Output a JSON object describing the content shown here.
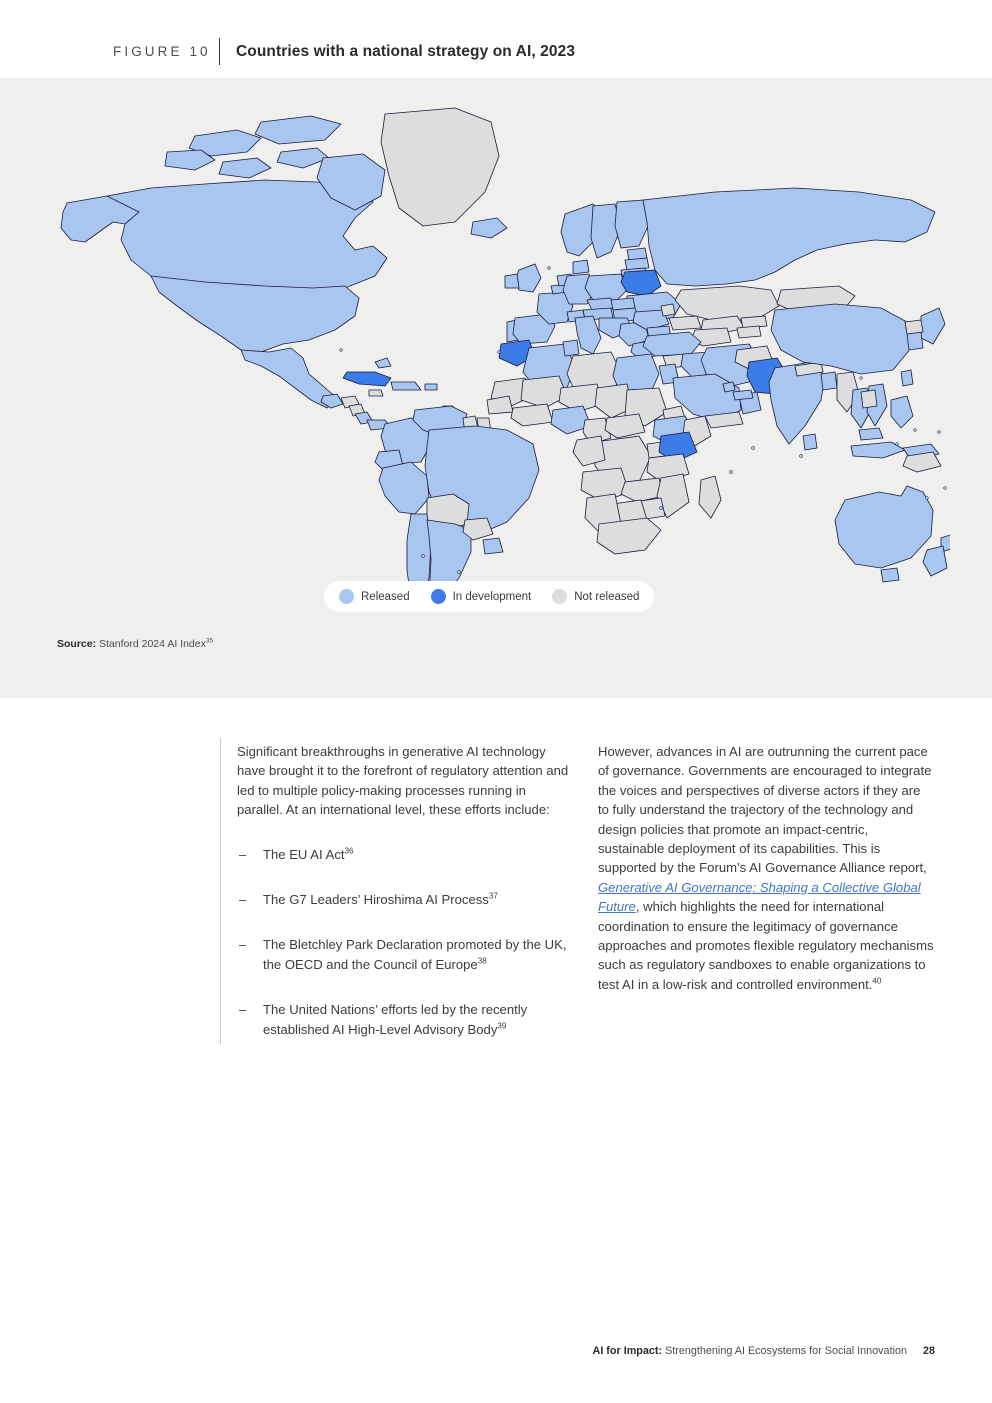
{
  "figure": {
    "label": "FIGURE 10",
    "title": "Countries with a national strategy on AI, 2023",
    "source_label": "Source:",
    "source_text": " Stanford 2024 AI Index",
    "source_superscript": "35"
  },
  "legend": {
    "items": [
      {
        "label": "Released",
        "color": "#a8c6f0",
        "key": "released"
      },
      {
        "label": "In development",
        "color": "#3c7ce8",
        "key": "in-development"
      },
      {
        "label": "Not released",
        "color": "#dcdedd",
        "key": "not-released"
      }
    ]
  },
  "map": {
    "ocean_color": "#efefed",
    "border_color": "#1a1a3c",
    "colors": {
      "released": "#a8c6f0",
      "in_development": "#3c7ce8",
      "not_released": "#dcdedd"
    }
  },
  "body": {
    "left_column": {
      "intro": "Significant breakthroughs in generative AI technology have brought it to the forefront of regulatory attention and led to multiple policy-making processes running in parallel. At an international level, these efforts include:",
      "bullet_dash": "–",
      "bullets": [
        {
          "text": "The EU AI Act",
          "superscript": "36"
        },
        {
          "text": "The G7 Leaders’ Hiroshima AI Process",
          "superscript": "37"
        },
        {
          "text": "The Bletchley Park Declaration promoted by the UK, the OECD and the Council of Europe",
          "superscript": "38"
        },
        {
          "text": "The United Nations’ efforts led by the recently established AI High-Level Advisory Body",
          "superscript": "39"
        }
      ]
    },
    "right_column": {
      "part1": "However, advances in AI are outrunning the current pace of governance. Governments are encouraged to integrate the voices and perspectives of diverse actors if they are to fully understand the trajectory of the technology and design policies that promote an impact-centric, sustainable deployment of its capabilities. This is supported by the Forum’s AI Governance Alliance report, ",
      "link_text": "Generative AI Governance: Shaping a Collective Global Future",
      "part2": ", which highlights the need for international coordination to ensure the legitimacy of governance approaches and promotes flexible regulatory mechanisms such as regulatory sandboxes to enable organizations to test AI in a low-risk and controlled environment.",
      "part2_superscript": "40",
      "link_color": "#3f76c7"
    }
  },
  "footer": {
    "title": "AI for Impact:",
    "subtitle": " Strengthening AI Ecosystems for Social Innovation",
    "page_number": "28"
  }
}
